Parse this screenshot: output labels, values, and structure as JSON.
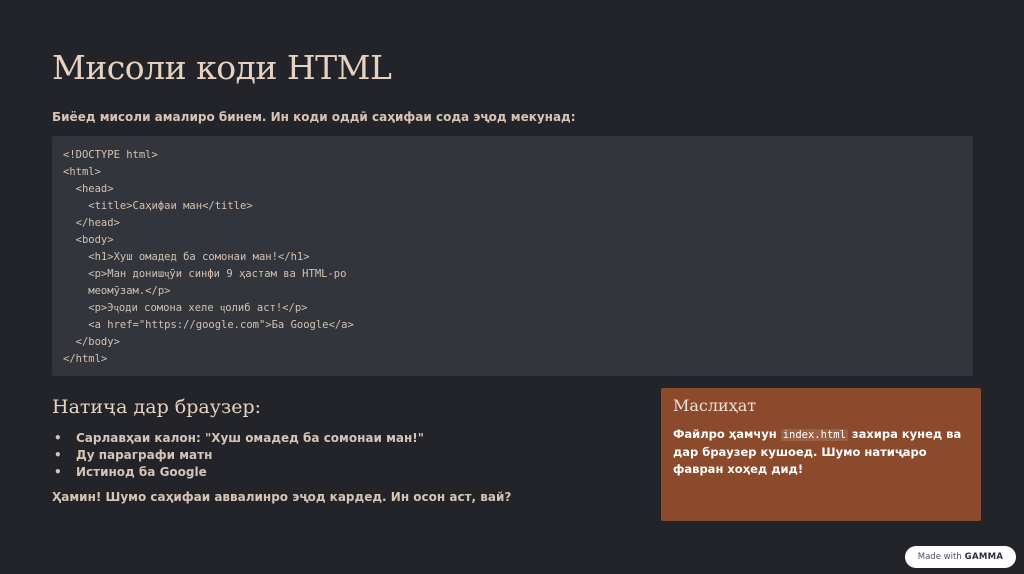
{
  "title": "Мисоли коди HTML",
  "intro": "Биёед мисоли амалиро бинем. Ин коди оддӣ саҳифаи сода эҷод мекунад:",
  "code_lines": [
    "<!DOCTYPE html>",
    "<html>",
    "  <head>",
    "    <title>Саҳифаи ман</title>",
    "  </head>",
    "  <body>",
    "    <h1>Хуш омадед ба сомонаи ман!</h1>",
    "    <p>Ман донишҷӯи синфи 9 ҳастам ва HTML-ро",
    "    меомӯзам.</p>",
    "    <p>Эҷоди сомона хеле ҷолиб аст!</p>",
    "    <a href=\"https://google.com\">Ба Google</a>",
    "  </body>",
    "</html>"
  ],
  "result": {
    "heading": "Натиҷа дар браузер:",
    "bullet_symbol": "•",
    "items": [
      "Сарлавҳаи калон: \"Хуш омадед ба сомонаи ман!\"",
      "Ду параграфи матн",
      "Истинод ба Google"
    ],
    "conclusion": "Ҳамин! Шумо саҳифаи аввалинро эҷод кардед. Ин осон аст, вай?"
  },
  "advice": {
    "title": "Маслиҳат",
    "text_before": "Файлро ҳамчун ",
    "code": "index.html",
    "text_after": " захира кунед ва дар браузер кушоед. Шумо натиҷаро фавран хоҳед дид!",
    "color": "#8a4a2b"
  },
  "badge": {
    "prefix": "Made with",
    "brand": "GAMMA"
  },
  "colors": {
    "background": "#222429",
    "code_background": "#32353b",
    "heading": "#e6d2c0"
  }
}
